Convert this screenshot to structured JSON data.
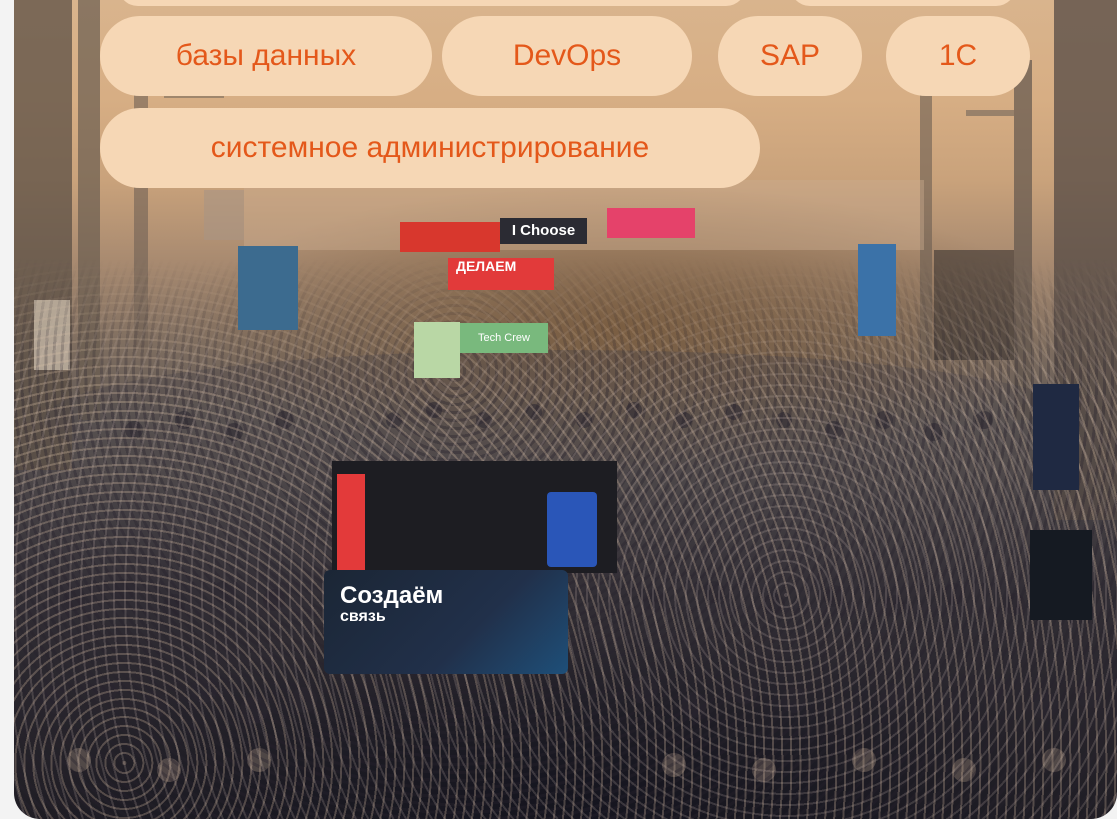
{
  "tags": {
    "partial_left": "",
    "partial_right": "",
    "items": [
      "базы данных",
      "DevOps",
      "SAP",
      "1C",
      "системное администрирование"
    ]
  },
  "photo": {
    "booths": {
      "ichoose": "I Choose",
      "delaem": "ДЕЛАЕМ",
      "tech_crew": "Tech Crew",
      "sozdaem_title": "Создаём",
      "sozdaem_sub": "связь"
    }
  },
  "colors": {
    "tag_background": "#f6d7b5",
    "tag_text": "#e4581a"
  }
}
